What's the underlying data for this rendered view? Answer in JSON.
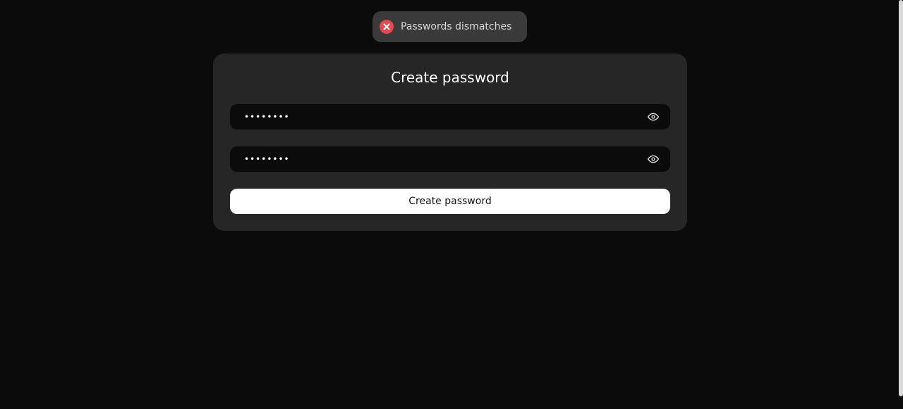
{
  "toast": {
    "message": "Passwords dismatches",
    "icon": "error-x-icon",
    "icon_color": "#e5484d"
  },
  "form": {
    "title": "Create password",
    "password": {
      "value": "12345678"
    },
    "confirm_password": {
      "value": "87654321"
    },
    "submit_label": "Create password"
  },
  "colors": {
    "background": "#0b0b0b",
    "card": "#262626",
    "toast": "#3a3a3a",
    "button": "#ffffff"
  }
}
